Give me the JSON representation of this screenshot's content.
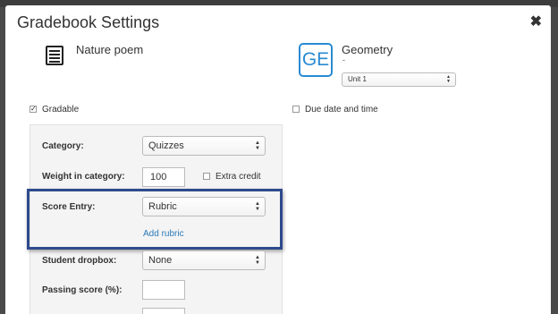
{
  "modal": {
    "title": "Gradebook Settings",
    "close_symbol": "✖"
  },
  "assignment": {
    "title": "Nature poem",
    "icon": "list-document-icon"
  },
  "course": {
    "badge": "GE",
    "name": "Geometry",
    "sub": "-",
    "unit_value": "Unit 1",
    "accent": "#2a8ad2"
  },
  "options": {
    "gradable_label": "Gradable",
    "gradable_checked": true,
    "due_date_label": "Due date and time",
    "due_date_checked": false
  },
  "form": {
    "category_label": "Category:",
    "category_value": "Quizzes",
    "weight_label": "Weight in category:",
    "weight_value": "100",
    "extra_credit_label": "Extra credit",
    "score_entry_label": "Score Entry:",
    "score_entry_value": "Rubric",
    "add_rubric_label": "Add rubric",
    "dropbox_label": "Student dropbox:",
    "dropbox_value": "None",
    "passing_label": "Passing score (%):",
    "passing_value": ""
  },
  "colors": {
    "highlight_border": "#2e4a8c",
    "link": "#2a7ab8"
  }
}
